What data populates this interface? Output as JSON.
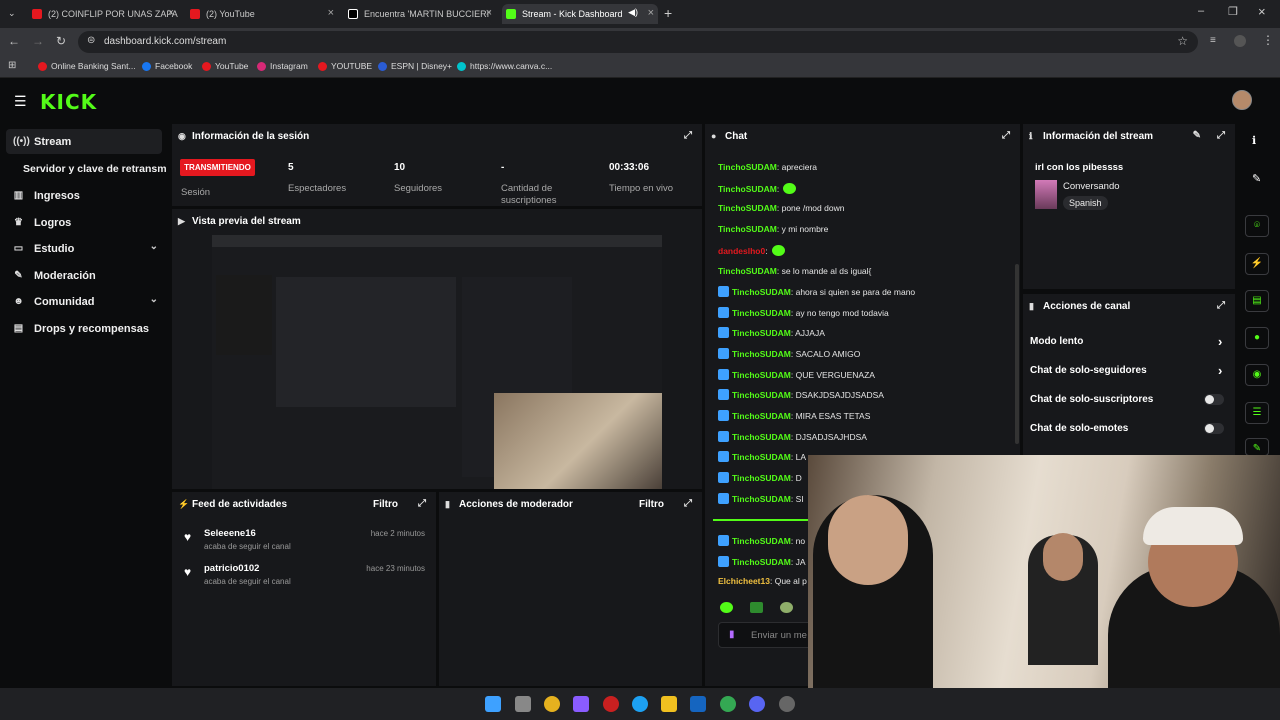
{
  "browser": {
    "tabs": [
      {
        "label": "(2) COINFLIP POR UNAS ZAPA",
        "color": "#e5181f"
      },
      {
        "label": "(2) YouTube",
        "color": "#e5181f"
      },
      {
        "label": "Encuentra 'MARTIN BUCCIERI'",
        "color": "#ffffff"
      },
      {
        "label": "Stream - Kick Dashboard",
        "color": "#53fc18"
      }
    ],
    "url": "dashboard.kick.com/stream",
    "bookmarks": [
      "Online Banking Sant...",
      "Facebook",
      "YouTube",
      "Instagram",
      "YOUTUBE",
      "ESPN | Disney+",
      "https://www.canva.c..."
    ]
  },
  "kick": {
    "logo": "KICK"
  },
  "sidebar": {
    "items": [
      {
        "label": "Stream",
        "icon": "broadcast-icon"
      },
      {
        "label": "Servidor y clave de retransm",
        "icon": ""
      },
      {
        "label": "Ingresos",
        "icon": "bank-icon"
      },
      {
        "label": "Logros",
        "icon": "trophy-icon"
      },
      {
        "label": "Estudio",
        "icon": "tv-icon"
      },
      {
        "label": "Moderación",
        "icon": "wrench-icon"
      },
      {
        "label": "Comunidad",
        "icon": "users-icon"
      },
      {
        "label": "Drops y recompensas",
        "icon": "gift-icon"
      }
    ]
  },
  "session": {
    "title": "Información de la sesión",
    "live_badge": "TRANSMITIENDO",
    "session_label": "Sesión",
    "viewers_value": "5",
    "viewers_label": "Espectadores",
    "followers_value": "10",
    "followers_label": "Seguidores",
    "subs_value": "-",
    "subs_label": "Cantidad de suscriptiones",
    "time_value": "00:33:06",
    "time_label": "Tiempo en vivo"
  },
  "preview": {
    "title": "Vista previa del stream"
  },
  "feed": {
    "title": "Feed de actividades",
    "filter": "Filtro",
    "items": [
      {
        "user": "Seleeene16",
        "action": "acaba de seguir el canal",
        "time": "hace 2 minutos"
      },
      {
        "user": "patricio0102",
        "action": "acaba de seguir el canal",
        "time": "hace 23 minutos"
      }
    ]
  },
  "mod_actions": {
    "title": "Acciones de moderador",
    "filter": "Filtro"
  },
  "chat": {
    "title": "Chat",
    "placeholder": "Enviar un me",
    "messages": [
      {
        "user": "TinchoSUDAM",
        "text": ": apreciera",
        "badge": false
      },
      {
        "user": "TinchoSUDAM",
        "text": ":",
        "badge": false,
        "emote": true
      },
      {
        "user": "TinchoSUDAM",
        "text": ": pone /mod down",
        "badge": false
      },
      {
        "user": "TinchoSUDAM",
        "text": ": y mi nombre",
        "badge": false
      },
      {
        "user": "dandeslho0",
        "text": ":",
        "badge": false,
        "emote": true
      },
      {
        "user": "TinchoSUDAM",
        "text": ": se lo mande al ds igual{",
        "badge": false
      },
      {
        "user": "TinchoSUDAM",
        "text": ": ahora si quien se para de mano",
        "badge": true
      },
      {
        "user": "TinchoSUDAM",
        "text": ": ay no tengo mod todavia",
        "badge": true
      },
      {
        "user": "TinchoSUDAM",
        "text": ": AJJAJA",
        "badge": true
      },
      {
        "user": "TinchoSUDAM",
        "text": ": SACALO AMIGO",
        "badge": true
      },
      {
        "user": "TinchoSUDAM",
        "text": ": QUE VERGUENAZA",
        "badge": true
      },
      {
        "user": "TinchoSUDAM",
        "text": ": DSAKJDSAJDJSADSA",
        "badge": true
      },
      {
        "user": "TinchoSUDAM",
        "text": ": MIRA ESAS TETAS",
        "badge": true
      },
      {
        "user": "TinchoSUDAM",
        "text": ": DJSADJSAJHDSA",
        "badge": true
      },
      {
        "user": "TinchoSUDAM",
        "text": ": LA",
        "badge": true
      },
      {
        "user": "TinchoSUDAM",
        "text": ": D",
        "badge": true
      },
      {
        "user": "TinchoSUDAM",
        "text": ": SI",
        "badge": true
      },
      {
        "user": "TinchoSUDAM",
        "text": ": no",
        "badge": true
      },
      {
        "user": "TinchoSUDAM",
        "text": ": JA",
        "badge": true
      },
      {
        "user": "Elchicheet13",
        "text": ": Que al p",
        "badge": false
      }
    ]
  },
  "stream_info": {
    "title": "Información del stream",
    "stream_title": "irl con los pibessss",
    "category": "Conversando",
    "language": "Spanish"
  },
  "channel_actions": {
    "title": "Acciones de canal",
    "items": [
      {
        "label": "Modo lento",
        "type": "arrow"
      },
      {
        "label": "Chat de solo-seguidores",
        "type": "arrow"
      },
      {
        "label": "Chat de solo-suscriptores",
        "type": "toggle"
      },
      {
        "label": "Chat de solo-emotes",
        "type": "toggle"
      }
    ]
  }
}
